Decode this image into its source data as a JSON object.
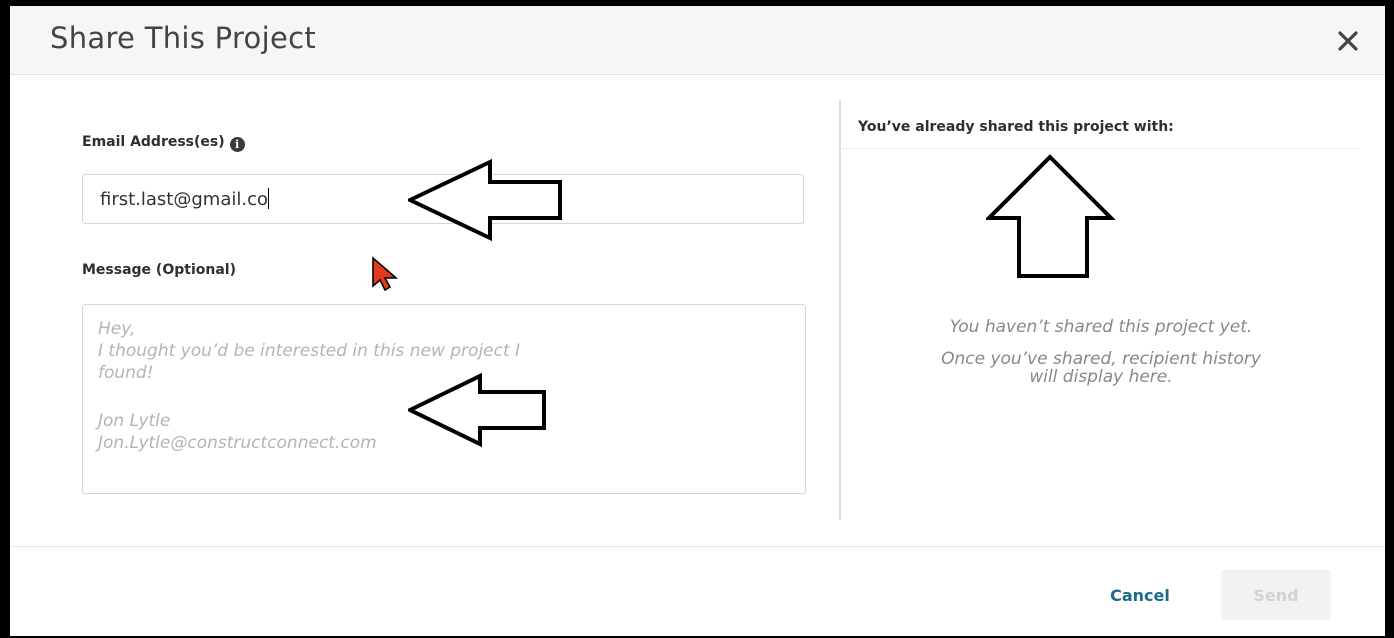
{
  "dialog": {
    "title": "Share This Project",
    "close_icon": "close-icon"
  },
  "form": {
    "email_label": "Email Address(es)",
    "email_info_icon": "info-icon",
    "email_value": "first.last@gmail.co",
    "message_label": "Message (Optional)",
    "message_placeholder_lines": [
      "Hey,",
      "I thought you’d be interested in this new project I",
      "found!",
      "",
      "Jon Lytle",
      "Jon.Lytle@constructconnect.com"
    ]
  },
  "shared_panel": {
    "heading": "You’ve already shared this project with:",
    "empty_title": "You haven’t shared this project yet.",
    "empty_detail_line1": "Once you’ve shared, recipient history",
    "empty_detail_line2": "will display here."
  },
  "footer": {
    "cancel_label": "Cancel",
    "send_label": "Send"
  },
  "colors": {
    "link_blue": "#1d6b8a",
    "cursor_red": "#e23b17",
    "header_bg": "#f6f6f6"
  }
}
